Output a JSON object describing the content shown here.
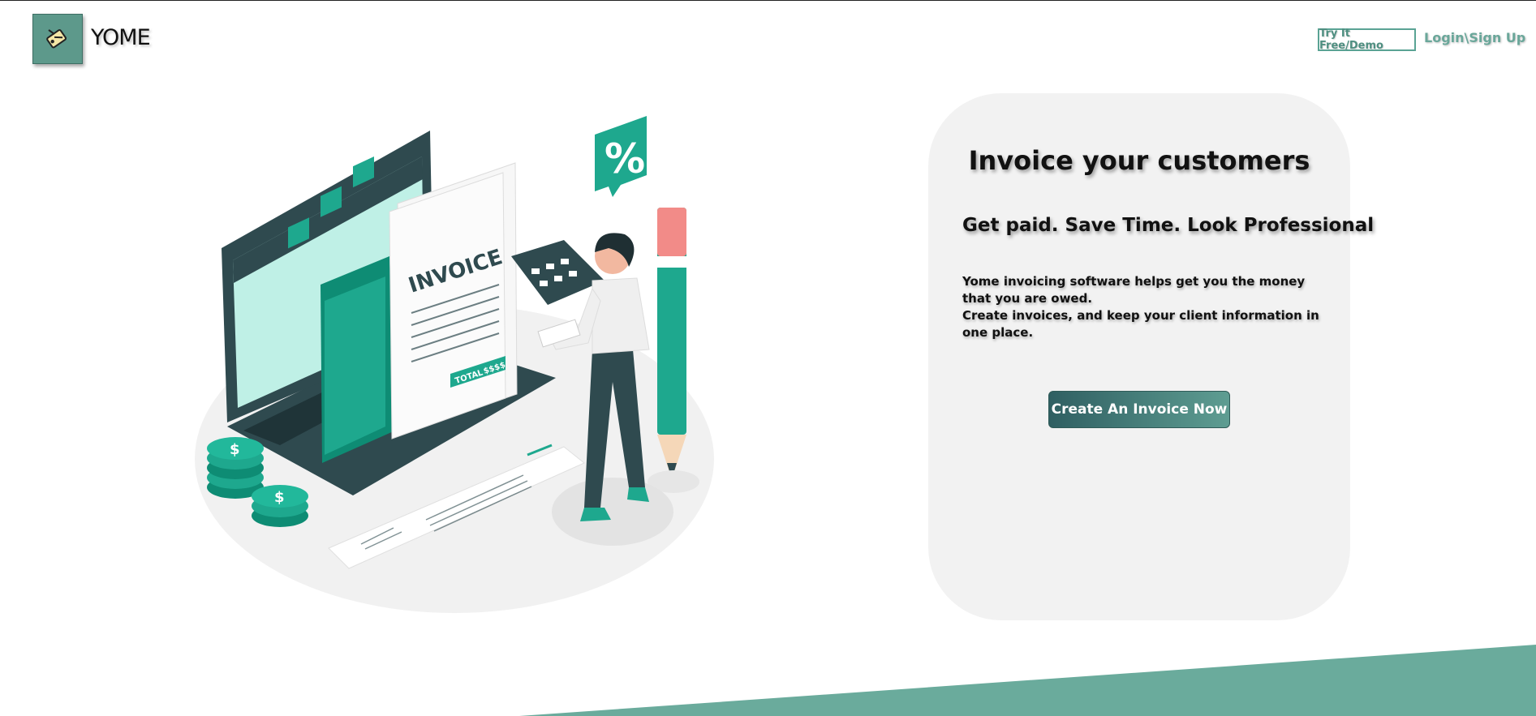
{
  "header": {
    "brand": "YOME",
    "try_label": "Try It Free/Demo",
    "login_label": "Login\\Sign Up"
  },
  "illustration": {
    "invoice_text": "INVOICE",
    "total_text": "TOTAL",
    "amount_text": "$$$$",
    "percent_text": "%",
    "coin_symbol": "$"
  },
  "hero": {
    "title": "Invoice your customers",
    "subtitle": "Get paid. Save Time. Look Professional",
    "line1": "Yome invoicing software helps get you the money that you are owed.",
    "line2": "Create invoices, and keep your client information in one place.",
    "cta_label": "Create An Invoice Now"
  },
  "colors": {
    "accent": "#5d998b",
    "teal": "#1ea88e",
    "dark": "#2f4a4f",
    "card_bg": "#f2f2f2",
    "wedge": "#6aab9c"
  }
}
